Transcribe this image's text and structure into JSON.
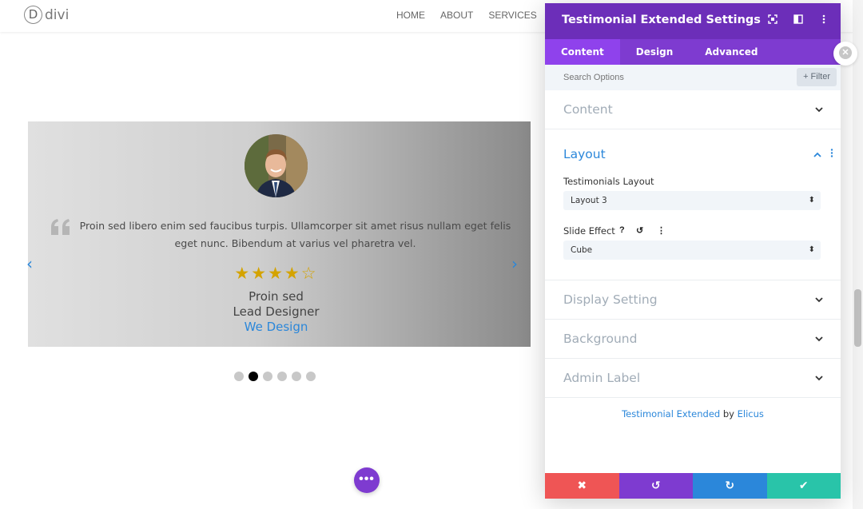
{
  "site": {
    "logo_letter": "D",
    "logo_text": "divi",
    "nav": [
      "HOME",
      "ABOUT",
      "SERVICES",
      "P"
    ]
  },
  "testimonial": {
    "quote": "Proin sed libero enim sed faucibus turpis. Ullamcorper sit amet risus nullam eget felis eget nunc. Bibendum at varius vel pharetra vel.",
    "rating": "4 of 5",
    "stars": "★★★★☆",
    "name": "Proin sed",
    "role": "Lead Designer",
    "company": "We Design",
    "prev_arrow": "‹",
    "next_arrow": "›",
    "dots_total": 6,
    "active_dot": 2
  },
  "fab": {
    "label": "•••"
  },
  "panel": {
    "title": "Testimonial Extended Settings",
    "tabs": [
      "Content",
      "Design",
      "Advanced"
    ],
    "active_tab": "Content",
    "search_placeholder": "Search Options",
    "filter_label": "+ Filter",
    "sections": {
      "content": "Content",
      "layout": "Layout",
      "display": "Display Setting",
      "background": "Background",
      "admin": "Admin Label"
    },
    "layout_field": {
      "label": "Testimonials Layout",
      "value": "Layout 3"
    },
    "slide_field": {
      "label": "Slide Effect",
      "value": "Cube",
      "help_icon": "?",
      "reset_icon": "↺",
      "more_icon": "⋮"
    },
    "credit": {
      "product": "Testimonial Extended",
      "by": "by",
      "vendor": "Elicus"
    },
    "actions": {
      "cancel": "✖",
      "undo": "↺",
      "redo": "↻",
      "save": "✔"
    },
    "colors": {
      "header": "#6c2eb9",
      "tabs": "#7e3bd0",
      "cancel": "#ef5555",
      "undo": "#7e3bd0",
      "redo": "#2b87da",
      "save": "#29c4a9",
      "accent": "#2b87da"
    }
  }
}
